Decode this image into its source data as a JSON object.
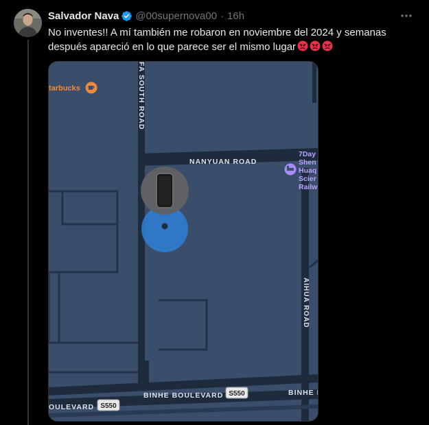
{
  "tweet": {
    "author_name": "Salvador Nava",
    "handle": "@00supernova00",
    "separator": "·",
    "time": "16h",
    "text": "No inventes!! A mí también me robaron en noviembre del 2024 y semanas después apareció en lo que parece ser el mismo lugar"
  },
  "icons": {
    "verified": "verified-badge-icon",
    "more": "more-options-icon",
    "emoji": "angry-face-emoji"
  },
  "map": {
    "poi_starbucks": "tarbucks",
    "road_fa_south": "FA SOUTH ROAD",
    "road_nanyuan": "NANYUAN ROAD",
    "hotel_label": [
      "7Day",
      "Shen",
      "Huaq",
      "Scier",
      "Railw"
    ],
    "road_aihua": "AIHUA ROAD",
    "road_binhe_1": "BINHE BOULEVARD",
    "road_binhe_2": "BINHE B",
    "road_boulevard": "OULEVARD",
    "shield_1": "S550",
    "shield_2": "S550"
  },
  "colors": {
    "map_bg": "#3a4d6b",
    "road": "#1e2b3c",
    "accent_blue": "#1d9bf0",
    "location_dot": "#2f7fd6",
    "poi_orange": "#f08a3a",
    "poi_purple": "#a78bfa"
  }
}
